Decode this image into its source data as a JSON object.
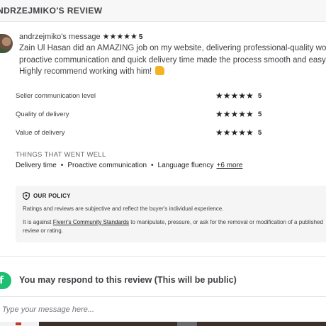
{
  "header": {
    "title": "NDRZEJMIKO'S REVIEW"
  },
  "review": {
    "author_line": "andrzejmiko's message",
    "stars": "★★★★★",
    "score": "5",
    "lines": [
      "Zain Ul Hasan did an AMAZING job on my website, delivering professional-quality work",
      "proactive communication and quick delivery time made the process smooth and easy.",
      "Highly recommend working with him!"
    ]
  },
  "ratings": [
    {
      "label": "Seller communication level",
      "stars": "★★★★★",
      "score": "5"
    },
    {
      "label": "Quality of delivery",
      "stars": "★★★★★",
      "score": "5"
    },
    {
      "label": "Value of delivery",
      "stars": "★★★★★",
      "score": "5"
    }
  ],
  "went_well": {
    "title": "THINGS THAT WENT WELL",
    "tags": [
      "Delivery time",
      "Proactive communication",
      "Language fluency"
    ],
    "more": "+6 more"
  },
  "policy": {
    "title": "OUR POLICY",
    "p1": "Ratings and reviews are subjective and reflect the buyer's individual experience.",
    "p2_before": "It is against ",
    "p2_link": "Fiverr's Community Standards",
    "p2_after": " to manipulate, pressure, or ask for the removal or modification of a published review or rating."
  },
  "respond": {
    "logo_letter": "f",
    "title": "You may respond to this review (This will be public)",
    "placeholder": "Type your message here..."
  },
  "icons": {
    "shield": "shield-icon",
    "thumbs_up": "thumbs-up-icon",
    "fiverr_logo": "fiverr-logo-icon"
  },
  "colors": {
    "brand_green": "#1dbf73",
    "star": "#222325"
  }
}
